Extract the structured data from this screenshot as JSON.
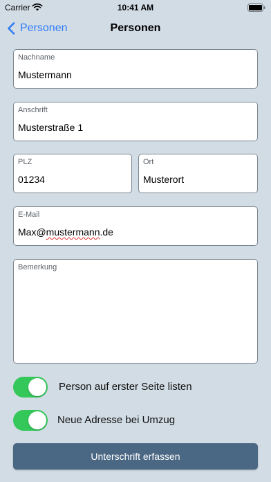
{
  "status": {
    "carrier": "Carrier",
    "time": "10:41 AM"
  },
  "nav": {
    "back_label": "Personen",
    "title": "Personen"
  },
  "form": {
    "nachname": {
      "label": "Nachname",
      "value": "Mustermann"
    },
    "anschrift": {
      "label": "Anschrift",
      "value": "Musterstraße 1"
    },
    "plz": {
      "label": "PLZ",
      "value": "01234"
    },
    "ort": {
      "label": "Ort",
      "value": "Musterort"
    },
    "email": {
      "label": "E-Mail",
      "value_prefix": "Max@",
      "value_misspelled": "mustermann",
      "value_suffix": ".de"
    },
    "bemerkung": {
      "label": "Bemerkung",
      "value": ""
    }
  },
  "toggles": {
    "first_page": {
      "label": "Person auf erster Seite listen",
      "on": true
    },
    "new_address": {
      "label": "Neue Adresse bei Umzug",
      "on": true
    }
  },
  "actions": {
    "signature_label": "Unterschrift erfassen"
  },
  "colors": {
    "accent": "#2f7cf6",
    "toggle_on": "#34c759",
    "button_bg": "#4a6783",
    "background": "#d2dce5"
  }
}
